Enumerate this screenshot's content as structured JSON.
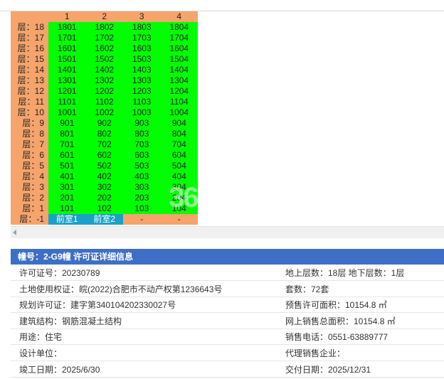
{
  "grid": {
    "columns": [
      "1",
      "2",
      "3",
      "4"
    ],
    "rows": [
      {
        "floor": "层：18",
        "units": [
          "1801",
          "1802",
          "1803",
          "1804"
        ]
      },
      {
        "floor": "层：17",
        "units": [
          "1701",
          "1702",
          "1703",
          "1704"
        ]
      },
      {
        "floor": "层：16",
        "units": [
          "1601",
          "1602",
          "1603",
          "1604"
        ]
      },
      {
        "floor": "层：15",
        "units": [
          "1501",
          "1502",
          "1503",
          "1504"
        ]
      },
      {
        "floor": "层：14",
        "units": [
          "1401",
          "1402",
          "1403",
          "1404"
        ]
      },
      {
        "floor": "层：13",
        "units": [
          "1301",
          "1302",
          "1303",
          "1304"
        ]
      },
      {
        "floor": "层：12",
        "units": [
          "1201",
          "1202",
          "1203",
          "1204"
        ]
      },
      {
        "floor": "层：11",
        "units": [
          "1101",
          "1102",
          "1103",
          "1104"
        ]
      },
      {
        "floor": "层：10",
        "units": [
          "1001",
          "1002",
          "1003",
          "1004"
        ]
      },
      {
        "floor": "层：9",
        "units": [
          "901",
          "902",
          "903",
          "904"
        ]
      },
      {
        "floor": "层：8",
        "units": [
          "801",
          "802",
          "803",
          "804"
        ]
      },
      {
        "floor": "层：7",
        "units": [
          "701",
          "702",
          "703",
          "704"
        ]
      },
      {
        "floor": "层：6",
        "units": [
          "601",
          "602",
          "603",
          "604"
        ]
      },
      {
        "floor": "层：5",
        "units": [
          "501",
          "502",
          "503",
          "504"
        ]
      },
      {
        "floor": "层：4",
        "units": [
          "401",
          "402",
          "403",
          "404"
        ]
      },
      {
        "floor": "层：3",
        "units": [
          "301",
          "302",
          "303",
          "304"
        ]
      },
      {
        "floor": "层：2",
        "units": [
          "201",
          "202",
          "203",
          "204"
        ]
      },
      {
        "floor": "层：1",
        "units": [
          "101",
          "102",
          "103",
          "104"
        ]
      },
      {
        "floor": "层：-1",
        "units": [
          "前室1",
          "前室2",
          "-",
          "-"
        ],
        "types": [
          "sp",
          "sp",
          "na",
          "na"
        ]
      }
    ],
    "watermark": "36"
  },
  "colors": {
    "header_orange": "#f5a46b",
    "available_green": "#00ff00",
    "special_blue": "#19a1c8",
    "panel_blue": "#3f6fc4"
  },
  "info": {
    "title": "幢号：2-G9幢 许可证详细信息",
    "rows": [
      {
        "left": "许可证号：20230789",
        "right": "地上层数：18层  地下层数：1层"
      },
      {
        "left": "土地使用权证：皖(2022)合肥市不动产权第1236643号",
        "right": "套数：72套"
      },
      {
        "left": "规划许可证：建字第340104202330027号",
        "right": "预售许可面积：10154.8 ㎡"
      },
      {
        "left": "建筑结构：钢筋混凝土结构",
        "right": "网上销售总面积：10154.8 ㎡"
      },
      {
        "left": "用途：住宅",
        "right": "销售电话：0551-63889777"
      },
      {
        "left": "设计单位：",
        "right": "代理销售企业："
      },
      {
        "left": "竣工日期：2025/6/30",
        "right": "交付日期：2025/12/31"
      }
    ]
  }
}
